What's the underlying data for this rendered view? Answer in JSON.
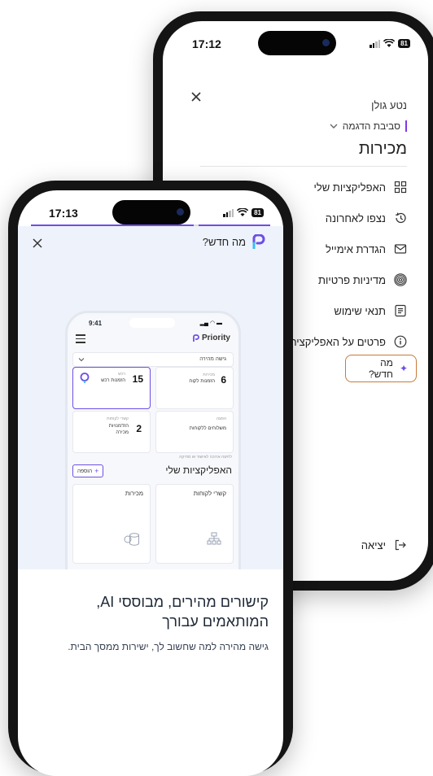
{
  "back_phone": {
    "time": "17:12",
    "battery": "81",
    "user_name": "נטע גולן",
    "environment": "סביבת הדגמה",
    "section_title": "מכירות",
    "menu": [
      {
        "label": "האפליקציות שלי",
        "icon": "grid-icon"
      },
      {
        "label": "נצפו לאחרונה",
        "icon": "history-icon"
      },
      {
        "label": "הגדרת אימייל",
        "icon": "mail-icon"
      },
      {
        "label": "מדיניות פרטיות",
        "icon": "fingerprint-icon"
      },
      {
        "label": "תנאי שימוש",
        "icon": "document-icon"
      },
      {
        "label": "פרטים על האפליקציה",
        "icon": "info-icon"
      }
    ],
    "whats_new": "מה חדש?",
    "logout": "יציאה"
  },
  "front_phone": {
    "time": "17:13",
    "battery": "81",
    "header_title": "מה חדש?",
    "preview": {
      "time": "9:41",
      "brand": "Priority",
      "quick_access": "גישה מהירה",
      "tiles": [
        {
          "caption": "מכירות",
          "number": "6",
          "label": "הזמנות לקוח"
        },
        {
          "caption": "רכש",
          "number": "15",
          "label": "הזמנות רכש"
        },
        {
          "caption": "הפצה",
          "number": "",
          "label": "משלוחים ללקוחות"
        },
        {
          "caption": "קשרי לקוחות",
          "number": "2",
          "label": "הזדמנויות מכירה"
        }
      ],
      "hint": "לחיצה ארוכה לאישור או מחיקה",
      "my_apps": "האפליקציות שלי",
      "add_button": "הוספה",
      "apps": [
        {
          "label": "קשרי לקוחות",
          "icon": "org-chart-icon"
        },
        {
          "label": "מכירות",
          "icon": "coins-icon"
        }
      ]
    },
    "headline_1": "קישורים מהירים, מבוססי AI,",
    "headline_2": "המותאמים עבורך",
    "subtext": "גישה מהירה למה שחשוב לך, ישירות ממסך הבית."
  },
  "colors": {
    "accent_purple": "#6d4ee6",
    "highlight_orange": "#c77a3a",
    "environment_bar": "#7c3aed",
    "light_blue_bg": "#eef3fb"
  }
}
